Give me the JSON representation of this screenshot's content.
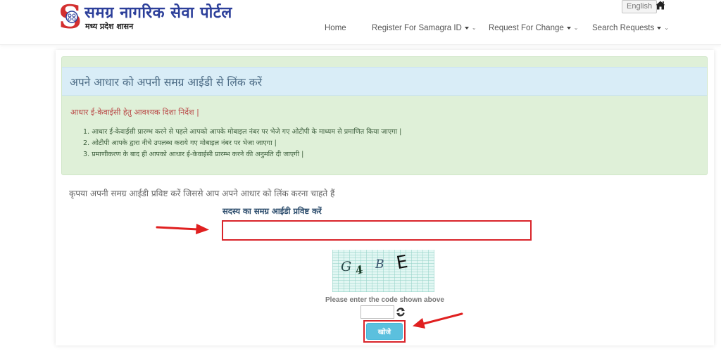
{
  "header": {
    "logo_letter": "S",
    "title": "समग्र नागरिक सेवा पोर्टल",
    "subtitle": "मध्य प्रदेश शासन",
    "language_button": "English",
    "home_icon": "home-icon"
  },
  "nav": {
    "items": [
      {
        "label": "Home",
        "has_dropdown": false
      },
      {
        "label": "Register For Samagra ID",
        "has_dropdown": true
      },
      {
        "label": "Request For Change",
        "has_dropdown": true
      },
      {
        "label": "Search Requests",
        "has_dropdown": true
      }
    ]
  },
  "panel": {
    "heading": "अपने आधार को अपनी समग्र आईडी से लिंक करें",
    "guidelines_title": "आधार ई-केवाईसी हेतु आवश्यक दिशा निर्देश |",
    "guidelines": [
      "1. आधार ई-केवाईसी प्रारम्भ करने से पहले आपको आपके मोबाइल नंबर पर भेजे गए ओटीपी के माध्यम से प्रमाणित किया जाएगा |",
      "2. ओटीपी आपके द्वारा नीचे उपलब्ध कराये गए मोबाइल नंबर पर भेजा जाएगा |",
      "3. प्रमाणीकरण के बाद ही आपको आधार ई-केवाईसी प्रारम्भ करने की अनुमति दी जाएगी |"
    ]
  },
  "form": {
    "instruction": "कृपया अपनी समग्र आईडी प्रविष्ट करें जिससे आप अपने आधार को लिंक करना चाहते हैं",
    "samagra_label": "सदस्य का समग्र आईडी प्रविष्ट करें",
    "samagra_value": "",
    "captcha_chars": [
      "G",
      "4",
      "B",
      "E"
    ],
    "captcha_hint": "Please enter the code shown above",
    "captcha_value": "",
    "search_button": "खोजे"
  },
  "colors": {
    "brand_blue": "#2c3f9a",
    "logo_red": "#d32f2f",
    "highlight_red": "#d9242a",
    "button_info": "#5bc0de",
    "alert_green": "#dff0d8",
    "alert_blue": "#d9edf7"
  }
}
